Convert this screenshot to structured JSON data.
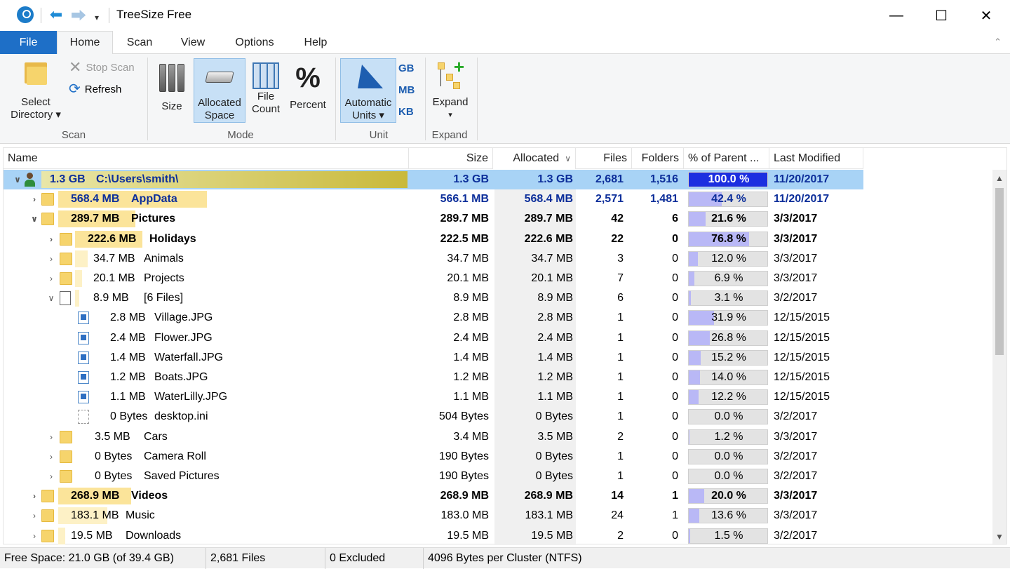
{
  "window": {
    "title": "TreeSize Free",
    "minimize": "—",
    "maximize": "☐",
    "close": "✕"
  },
  "quick_access": {
    "back": "⬅",
    "forward": "⮕",
    "dropdown": "▾"
  },
  "tabs": [
    {
      "label": "File"
    },
    {
      "label": "Home"
    },
    {
      "label": "Scan"
    },
    {
      "label": "View"
    },
    {
      "label": "Options"
    },
    {
      "label": "Help"
    }
  ],
  "ribbon": {
    "scan": {
      "select_directory": "Select Directory ▾",
      "select_directory_l1": "Select",
      "select_directory_l2": "Directory ▾",
      "stop_scan": "Stop Scan",
      "refresh": "Refresh",
      "group": "Scan"
    },
    "mode": {
      "size": "Size",
      "allocated_l1": "Allocated",
      "allocated_l2": "Space",
      "file_l1": "File",
      "file_l2": "Count",
      "percent": "Percent",
      "percent_glyph": "%",
      "group": "Mode"
    },
    "unit": {
      "auto_l1": "Automatic",
      "auto_l2": "Units ▾",
      "gb": "GB",
      "mb": "MB",
      "kb": "KB",
      "group": "Unit"
    },
    "expand": {
      "expand": "Expand",
      "expand_caret": "▾",
      "group": "Expand"
    }
  },
  "columns": {
    "name": "Name",
    "size": "Size",
    "allocated": "Allocated",
    "allocated_sort": "∨",
    "files": "Files",
    "folders": "Folders",
    "percent": "% of Parent ...",
    "modified": "Last Modified"
  },
  "rows": [
    {
      "caret": "∨",
      "label_size": "1.3 GB",
      "name": "C:\\Users\\smith\\",
      "size": "1.3 GB",
      "allocated": "1.3 GB",
      "files": "2,681",
      "folders": "1,516",
      "percent": "100.0 %",
      "pct": 1.0,
      "modified": "11/20/2017"
    },
    {
      "caret": "›",
      "label_size": "568.4 MB",
      "name": "AppData",
      "size": "566.1 MB",
      "allocated": "568.4 MB",
      "files": "2,571",
      "folders": "1,481",
      "percent": "42.4 %",
      "pct": 0.424,
      "modified": "11/20/2017"
    },
    {
      "caret": "∨",
      "label_size": "289.7 MB",
      "name": "Pictures",
      "size": "289.7 MB",
      "allocated": "289.7 MB",
      "files": "42",
      "folders": "6",
      "percent": "21.6 %",
      "pct": 0.216,
      "modified": "3/3/2017"
    },
    {
      "caret": "›",
      "label_size": "222.6 MB",
      "name": "Holidays",
      "size": "222.5 MB",
      "allocated": "222.6 MB",
      "files": "22",
      "folders": "0",
      "percent": "76.8 %",
      "pct": 0.768,
      "modified": "3/3/2017"
    },
    {
      "caret": "›",
      "label_size": "34.7 MB",
      "name": "Animals",
      "size": "34.7 MB",
      "allocated": "34.7 MB",
      "files": "3",
      "folders": "0",
      "percent": "12.0 %",
      "pct": 0.12,
      "modified": "3/3/2017"
    },
    {
      "caret": "›",
      "label_size": "20.1 MB",
      "name": "Projects",
      "size": "20.1 MB",
      "allocated": "20.1 MB",
      "files": "7",
      "folders": "0",
      "percent": "6.9 %",
      "pct": 0.069,
      "modified": "3/3/2017"
    },
    {
      "caret": "∨",
      "label_size": "8.9 MB",
      "name": "[6 Files]",
      "size": "8.9 MB",
      "allocated": "8.9 MB",
      "files": "6",
      "folders": "0",
      "percent": "3.1 %",
      "pct": 0.031,
      "modified": "3/2/2017"
    },
    {
      "caret": "",
      "label_size": "2.8 MB",
      "name": "Village.JPG",
      "size": "2.8 MB",
      "allocated": "2.8 MB",
      "files": "1",
      "folders": "0",
      "percent": "31.9 %",
      "pct": 0.319,
      "modified": "12/15/2015"
    },
    {
      "caret": "",
      "label_size": "2.4 MB",
      "name": "Flower.JPG",
      "size": "2.4 MB",
      "allocated": "2.4 MB",
      "files": "1",
      "folders": "0",
      "percent": "26.8 %",
      "pct": 0.268,
      "modified": "12/15/2015"
    },
    {
      "caret": "",
      "label_size": "1.4 MB",
      "name": "Waterfall.JPG",
      "size": "1.4 MB",
      "allocated": "1.4 MB",
      "files": "1",
      "folders": "0",
      "percent": "15.2 %",
      "pct": 0.152,
      "modified": "12/15/2015"
    },
    {
      "caret": "",
      "label_size": "1.2 MB",
      "name": "Boats.JPG",
      "size": "1.2 MB",
      "allocated": "1.2 MB",
      "files": "1",
      "folders": "0",
      "percent": "14.0 %",
      "pct": 0.14,
      "modified": "12/15/2015"
    },
    {
      "caret": "",
      "label_size": "1.1 MB",
      "name": "WaterLilly.JPG",
      "size": "1.1 MB",
      "allocated": "1.1 MB",
      "files": "1",
      "folders": "0",
      "percent": "12.2 %",
      "pct": 0.122,
      "modified": "12/15/2015"
    },
    {
      "caret": "",
      "label_size": "0 Bytes",
      "name": "desktop.ini",
      "size": "504 Bytes",
      "allocated": "0 Bytes",
      "files": "1",
      "folders": "0",
      "percent": "0.0 %",
      "pct": 0.0,
      "modified": "3/2/2017"
    },
    {
      "caret": "›",
      "label_size": "3.5 MB",
      "name": "Cars",
      "size": "3.4 MB",
      "allocated": "3.5 MB",
      "files": "2",
      "folders": "0",
      "percent": "1.2 %",
      "pct": 0.012,
      "modified": "3/3/2017"
    },
    {
      "caret": "›",
      "label_size": "0 Bytes",
      "name": "Camera Roll",
      "size": "190 Bytes",
      "allocated": "0 Bytes",
      "files": "1",
      "folders": "0",
      "percent": "0.0 %",
      "pct": 0.0,
      "modified": "3/2/2017"
    },
    {
      "caret": "›",
      "label_size": "0 Bytes",
      "name": "Saved Pictures",
      "size": "190 Bytes",
      "allocated": "0 Bytes",
      "files": "1",
      "folders": "0",
      "percent": "0.0 %",
      "pct": 0.0,
      "modified": "3/2/2017"
    },
    {
      "caret": "›",
      "label_size": "268.9 MB",
      "name": "Videos",
      "size": "268.9 MB",
      "allocated": "268.9 MB",
      "files": "14",
      "folders": "1",
      "percent": "20.0 %",
      "pct": 0.2,
      "modified": "3/3/2017"
    },
    {
      "caret": "›",
      "label_size": "183.1 MB",
      "name": "Music",
      "size": "183.0 MB",
      "allocated": "183.1 MB",
      "files": "24",
      "folders": "1",
      "percent": "13.6 %",
      "pct": 0.136,
      "modified": "3/3/2017"
    },
    {
      "caret": "›",
      "label_size": "19.5 MB",
      "name": "Downloads",
      "size": "19.5 MB",
      "allocated": "19.5 MB",
      "files": "2",
      "folders": "0",
      "percent": "1.5 %",
      "pct": 0.015,
      "modified": "3/2/2017"
    }
  ],
  "scrollbar": {
    "up": "▲",
    "down": "▼"
  },
  "status": {
    "free_space": "Free Space: 21.0 GB  (of 39.4 GB)",
    "files": "2,681  Files",
    "excluded": "0 Excluded",
    "cluster": "4096  Bytes per Cluster (NTFS)"
  },
  "colors": {
    "file_tab": "#1e6fc7",
    "selection": "#a8d3f6",
    "pct_fill": "#b9b8f6",
    "pct_fill_full": "#1c2fe0",
    "name_bar": "#fbe49a"
  }
}
